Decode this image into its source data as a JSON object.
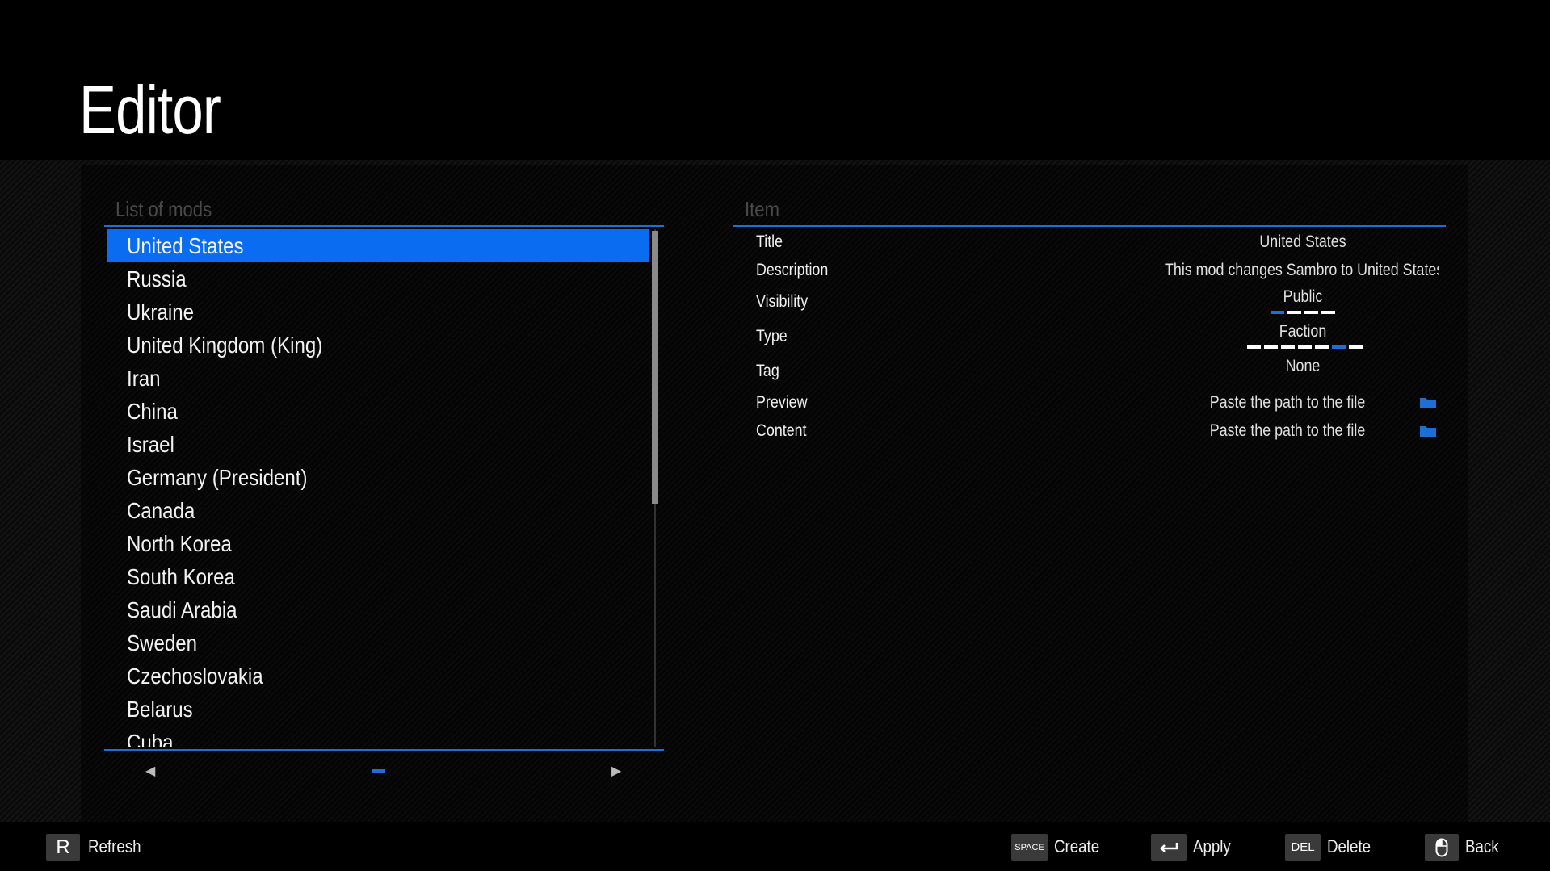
{
  "header": {
    "title": "Editor"
  },
  "list_panel": {
    "label": "List of mods",
    "items": [
      "United States",
      "Russia",
      "Ukraine",
      "United Kingdom (King)",
      "Iran",
      "China",
      "Israel",
      "Germany (President)",
      "Canada",
      "North Korea",
      "South Korea",
      "Saudi Arabia",
      "Sweden",
      "Czechoslovakia",
      "Belarus",
      "Cuba"
    ],
    "selected_index": 0,
    "prev_glyph": "◀",
    "next_glyph": "▶"
  },
  "item_panel": {
    "label": "Item",
    "title_label": "Title",
    "title_value": "United States",
    "description_label": "Description",
    "description_value": "This mod changes Sambro to United States of Ar",
    "visibility_label": "Visibility",
    "visibility_value": "Public",
    "type_label": "Type",
    "type_value": "Faction",
    "tag_label": "Tag",
    "tag_value": "None",
    "preview_label": "Preview",
    "preview_value": "Paste the path to the file",
    "content_label": "Content",
    "content_value": "Paste the path to the file",
    "visibility_option_count": 4,
    "visibility_active_index": 0,
    "type_option_count": 7,
    "type_active_index": 5
  },
  "footer": {
    "refresh_key": "R",
    "refresh_label": "Refresh",
    "create_key": "SPACE",
    "create_label": "Create",
    "apply_key_icon": "enter-key-icon",
    "apply_label": "Apply",
    "delete_key": "DEL",
    "delete_label": "Delete",
    "back_key_icon": "mouse-icon",
    "back_label": "Back"
  },
  "colors": {
    "accent": "#1d6fd6",
    "selected": "#0a6cf0",
    "background": "#000000"
  }
}
